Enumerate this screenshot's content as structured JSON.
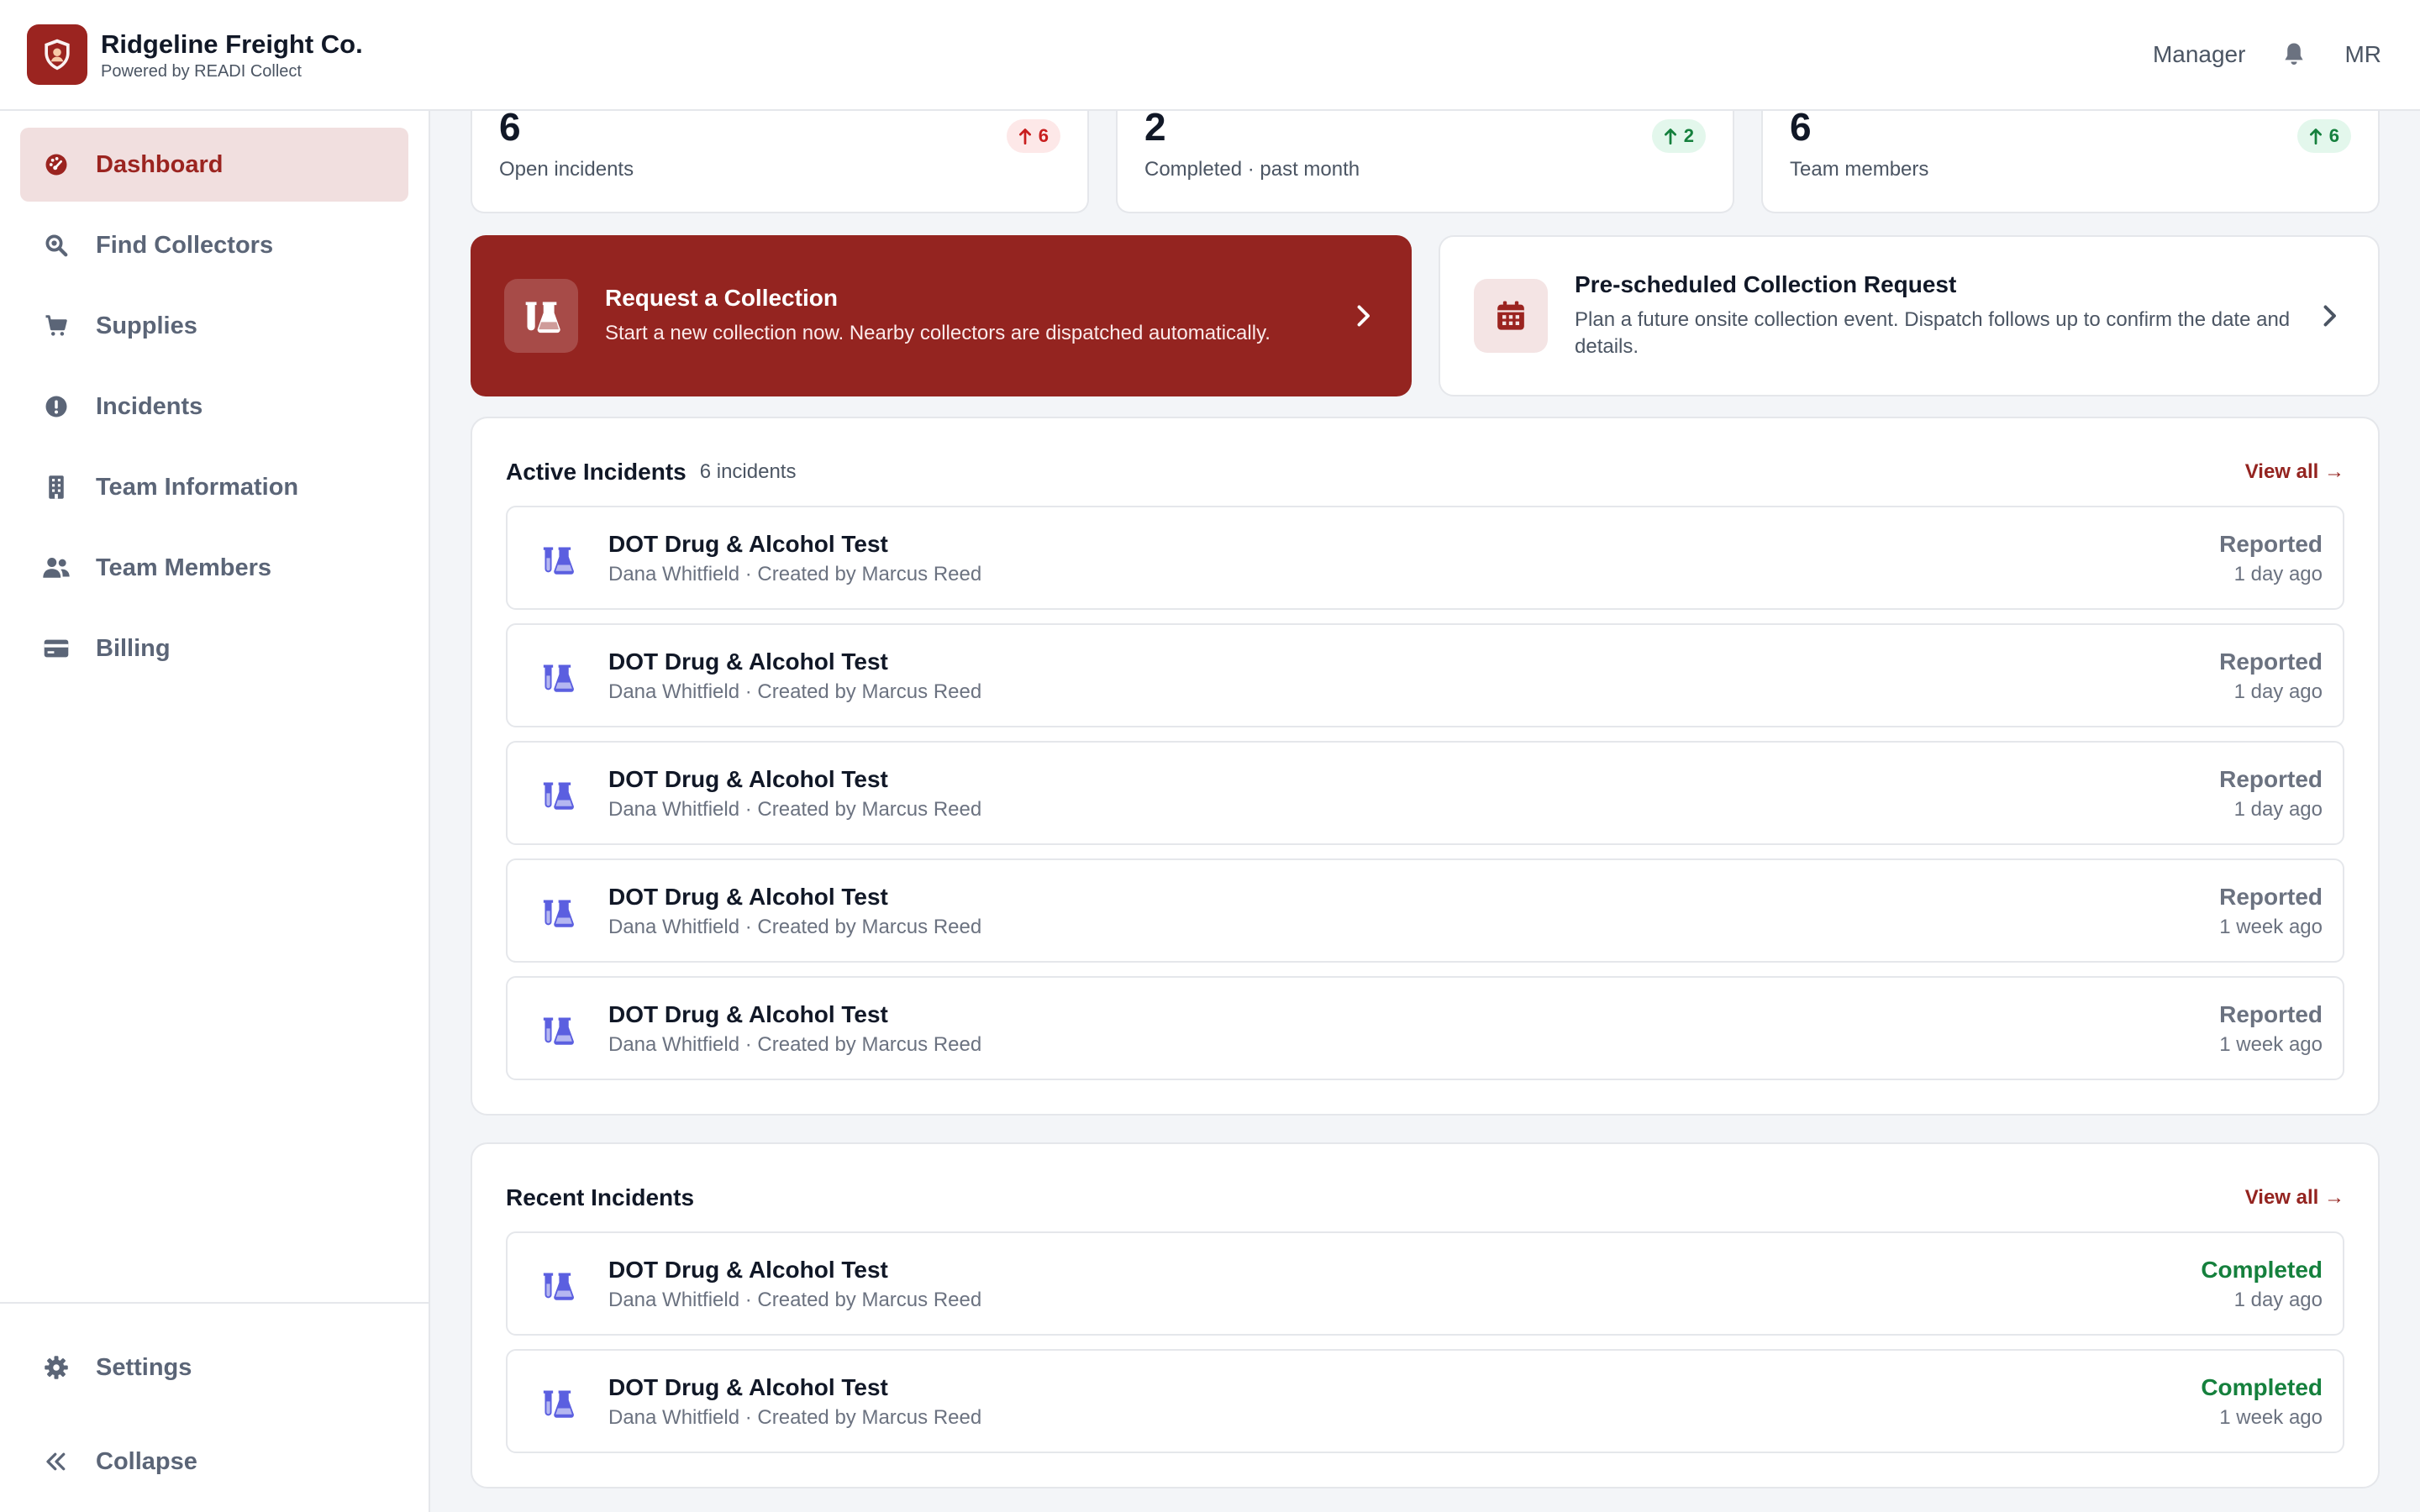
{
  "header": {
    "company_name": "Ridgeline Freight Co.",
    "powered_by": "Powered by READI Collect",
    "role": "Manager",
    "avatar_initials": "MR"
  },
  "sidebar": {
    "items": [
      {
        "label": "Dashboard",
        "icon": "dashboard-icon",
        "active": true
      },
      {
        "label": "Find Collectors",
        "icon": "search-icon"
      },
      {
        "label": "Supplies",
        "icon": "cart-icon"
      },
      {
        "label": "Incidents",
        "icon": "alert-icon"
      },
      {
        "label": "Team Information",
        "icon": "building-icon"
      },
      {
        "label": "Team Members",
        "icon": "users-icon"
      },
      {
        "label": "Billing",
        "icon": "credit-card-icon"
      }
    ],
    "settings_label": "Settings",
    "collapse_label": "Collapse"
  },
  "stats": [
    {
      "value": "6",
      "label": "Open incidents",
      "badge": "6",
      "trend": "up",
      "tone": "red"
    },
    {
      "value": "2",
      "label": "Completed · past month",
      "badge": "2",
      "trend": "up",
      "tone": "green"
    },
    {
      "value": "6",
      "label": "Team members",
      "badge": "6",
      "trend": "up",
      "tone": "green"
    }
  ],
  "actions": {
    "request": {
      "title": "Request a Collection",
      "description": "Start a new collection now. Nearby collectors are dispatched automatically."
    },
    "prescheduled": {
      "title": "Pre-scheduled Collection Request",
      "description": "Plan a future onsite collection event. Dispatch follows up to confirm the date and details."
    }
  },
  "active_incidents": {
    "title": "Active Incidents",
    "count_label": "6 incidents",
    "view_all": "View all →",
    "rows": [
      {
        "title": "DOT Drug & Alcohol Test",
        "subtitle": "Dana Whitfield · Created by Marcus Reed",
        "status": "Reported",
        "time": "1 day ago"
      },
      {
        "title": "DOT Drug & Alcohol Test",
        "subtitle": "Dana Whitfield · Created by Marcus Reed",
        "status": "Reported",
        "time": "1 day ago"
      },
      {
        "title": "DOT Drug & Alcohol Test",
        "subtitle": "Dana Whitfield · Created by Marcus Reed",
        "status": "Reported",
        "time": "1 day ago"
      },
      {
        "title": "DOT Drug & Alcohol Test",
        "subtitle": "Dana Whitfield · Created by Marcus Reed",
        "status": "Reported",
        "time": "1 week ago"
      },
      {
        "title": "DOT Drug & Alcohol Test",
        "subtitle": "Dana Whitfield · Created by Marcus Reed",
        "status": "Reported",
        "time": "1 week ago"
      }
    ]
  },
  "recent_incidents": {
    "title": "Recent Incidents",
    "view_all": "View all →",
    "rows": [
      {
        "title": "DOT Drug & Alcohol Test",
        "subtitle": "Dana Whitfield · Created by Marcus Reed",
        "status": "Completed",
        "time": "1 day ago"
      },
      {
        "title": "DOT Drug & Alcohol Test",
        "subtitle": "Dana Whitfield · Created by Marcus Reed",
        "status": "Completed",
        "time": "1 week ago"
      }
    ]
  },
  "colors": {
    "brand": "#942420",
    "active_nav_bg": "#f1dfdf",
    "completed": "#15803d",
    "reported": "#6b7280",
    "incident_icon": "#5b5fe0"
  }
}
